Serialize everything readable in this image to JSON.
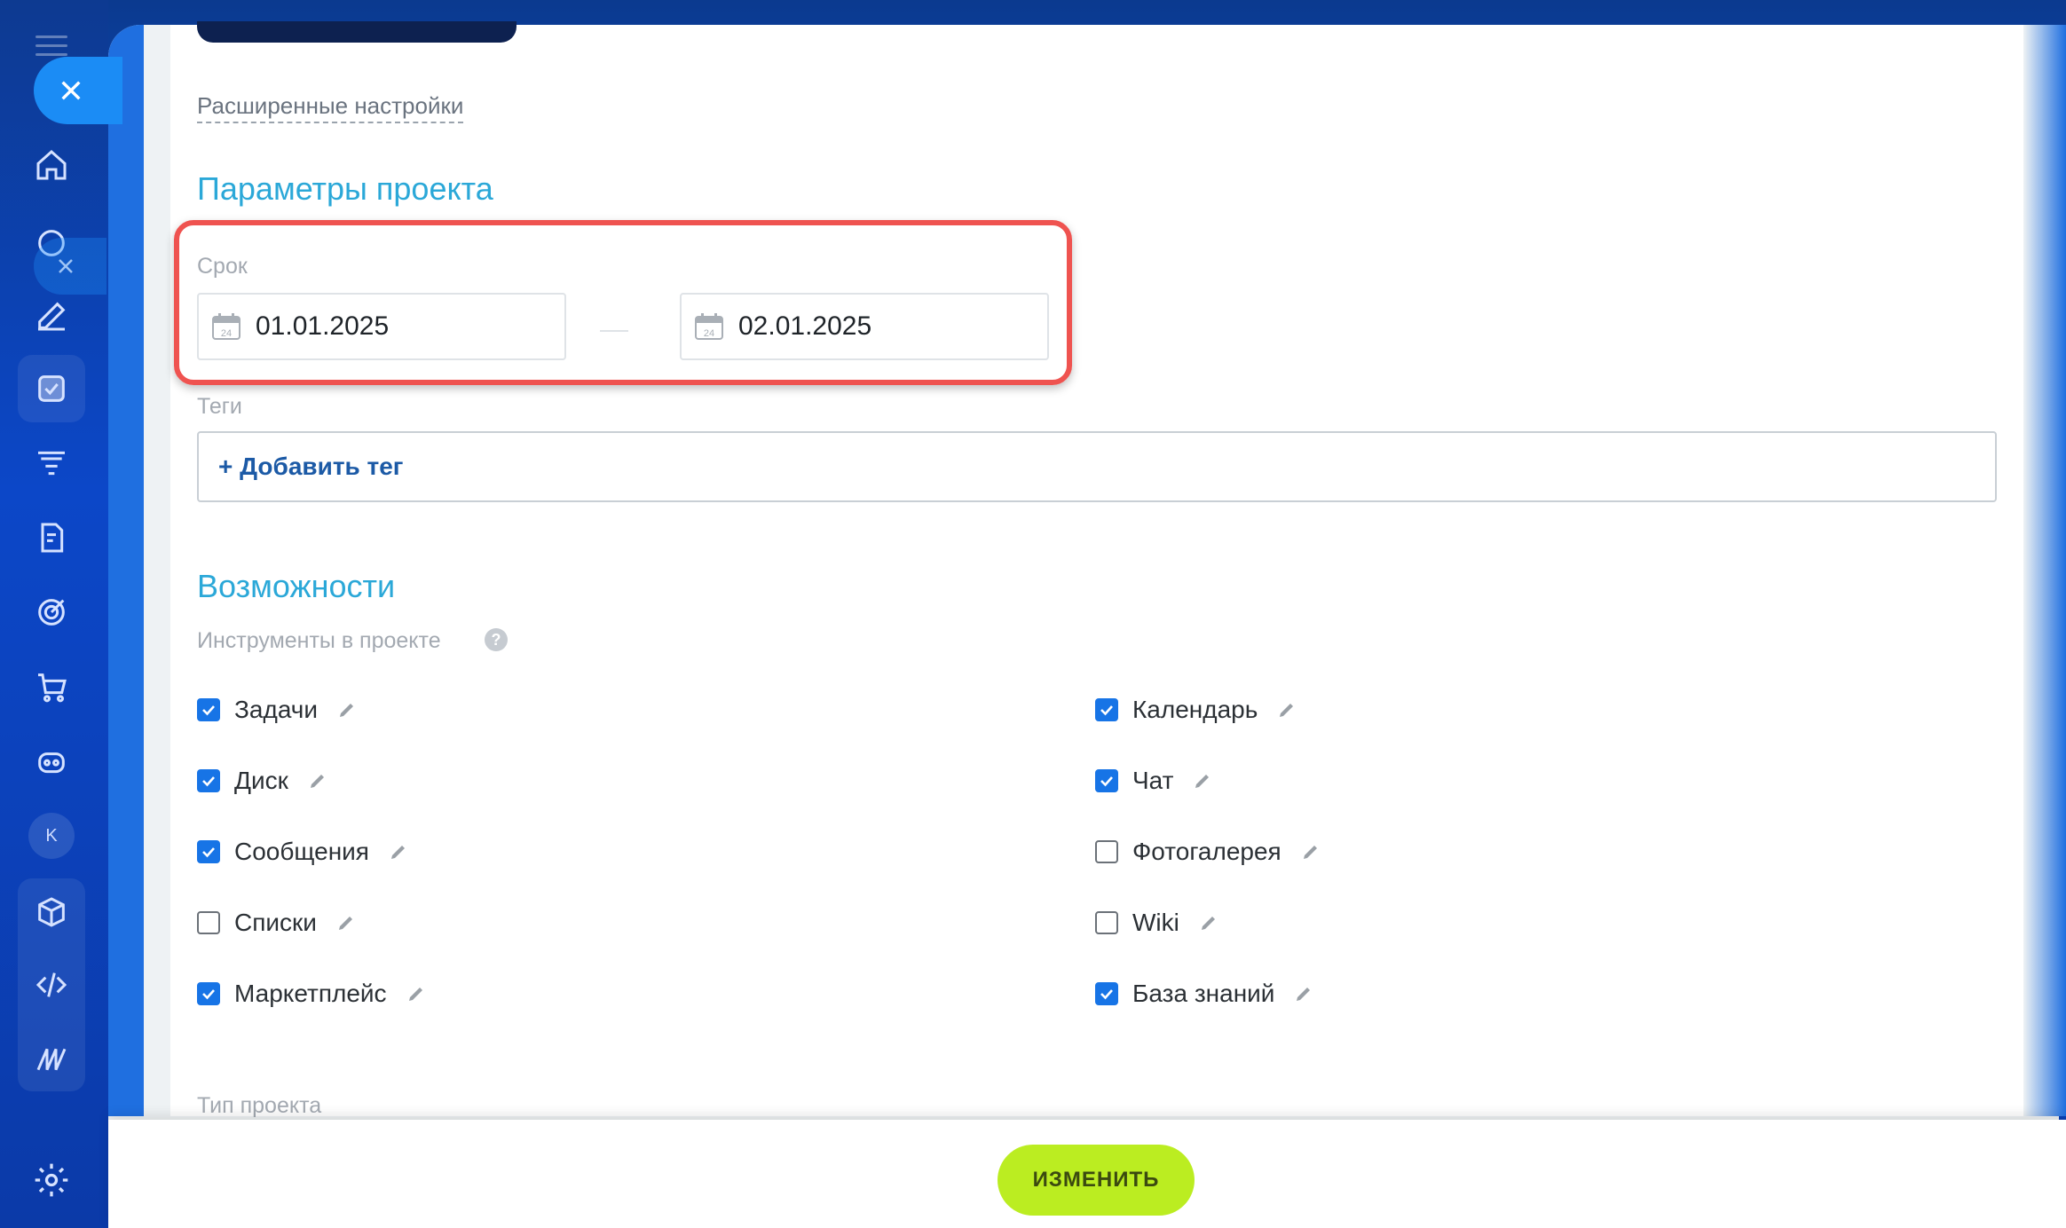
{
  "sidebar": {
    "avatar_initial": "K",
    "icons": [
      "menu-icon",
      "close-icon",
      "home-icon",
      "activity-icon",
      "edit-icon",
      "tasks-icon",
      "filter-icon",
      "document-icon",
      "target-icon",
      "cart-icon",
      "robot-icon",
      "box-icon",
      "code-icon",
      "signature-icon",
      "gear-icon"
    ]
  },
  "form": {
    "advanced_settings_link": "Расширенные настройки",
    "project_params_title": "Параметры проекта",
    "deadline_label": "Срок",
    "date_start": "01.01.2025",
    "date_end": "02.01.2025",
    "calendar_icon_day": "24",
    "tags_label": "Теги",
    "add_tag_label": "+ Добавить тег",
    "features_title": "Возможности",
    "tools_label": "Инструменты в проекте",
    "help_glyph": "?",
    "project_type_label": "Тип проекта"
  },
  "tools_left": [
    {
      "label": "Задачи",
      "checked": true
    },
    {
      "label": "Диск",
      "checked": true
    },
    {
      "label": "Сообщения",
      "checked": true
    },
    {
      "label": "Списки",
      "checked": false
    },
    {
      "label": "Маркетплейс",
      "checked": true
    }
  ],
  "tools_right": [
    {
      "label": "Календарь",
      "checked": true
    },
    {
      "label": "Чат",
      "checked": true
    },
    {
      "label": "Фотогалерея",
      "checked": false
    },
    {
      "label": "Wiki",
      "checked": false
    },
    {
      "label": "База знаний",
      "checked": true
    }
  ],
  "footer": {
    "save_button": "ИЗМЕНИТЬ"
  },
  "colors": {
    "accent_title": "#2ba8d8",
    "checkbox_blue": "#1774e6",
    "save_button_bg": "#bbed21",
    "highlight_border": "#ef5350"
  }
}
